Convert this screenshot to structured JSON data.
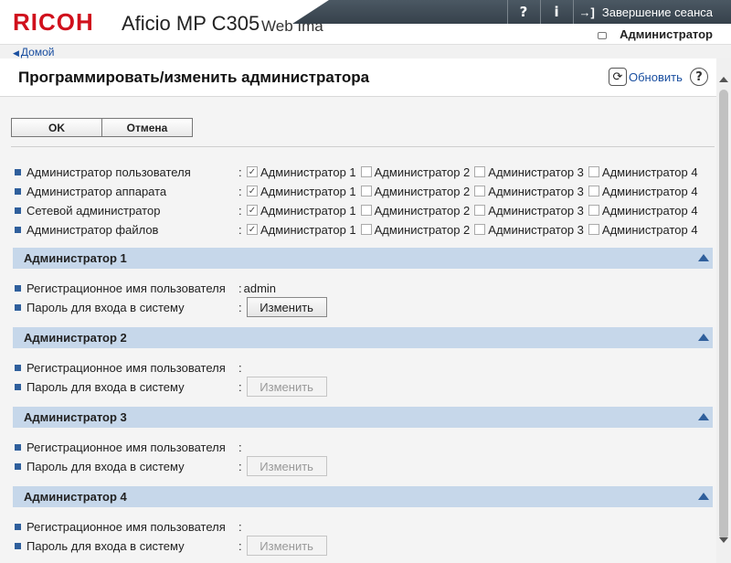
{
  "header": {
    "logo": "RICOH",
    "model": "Aficio MP C305",
    "product": "Web Ima",
    "help_label": "?",
    "info_label": "i",
    "logout_label": "Завершение сеанса",
    "user_role": "Администратор",
    "home_link": "Домой"
  },
  "page": {
    "title": "Программировать/изменить администратора",
    "refresh_label": "Обновить",
    "help_label": "?"
  },
  "buttons": {
    "ok": "OK",
    "cancel": "Отмена"
  },
  "permissions": {
    "options": [
      "Администратор 1",
      "Администратор 2",
      "Администратор 3",
      "Администратор 4"
    ],
    "rows": [
      {
        "label": "Администратор пользователя",
        "checked": [
          true,
          false,
          false,
          false
        ]
      },
      {
        "label": "Администратор аппарата",
        "checked": [
          true,
          false,
          false,
          false
        ]
      },
      {
        "label": "Сетевой администратор",
        "checked": [
          true,
          false,
          false,
          false
        ]
      },
      {
        "label": "Администратор файлов",
        "checked": [
          true,
          false,
          false,
          false
        ]
      }
    ]
  },
  "admins": [
    {
      "title": "Администратор 1",
      "login_label": "Регистрационное имя пользователя",
      "login_value": "admin",
      "password_label": "Пароль для входа в систему",
      "change_label": "Изменить",
      "enabled": true
    },
    {
      "title": "Администратор 2",
      "login_label": "Регистрационное имя пользователя",
      "login_value": "",
      "password_label": "Пароль для входа в систему",
      "change_label": "Изменить",
      "enabled": false
    },
    {
      "title": "Администратор 3",
      "login_label": "Регистрационное имя пользователя",
      "login_value": "",
      "password_label": "Пароль для входа в систему",
      "change_label": "Изменить",
      "enabled": false
    },
    {
      "title": "Администратор 4",
      "login_label": "Регистрационное имя пользователя",
      "login_value": "",
      "password_label": "Пароль для входа в систему",
      "change_label": "Изменить",
      "enabled": false
    }
  ],
  "colors": {
    "brand": "#d0101c",
    "section_bg": "#c6d7ea",
    "bullet": "#2f5f9c",
    "link": "#1a4fa0"
  }
}
